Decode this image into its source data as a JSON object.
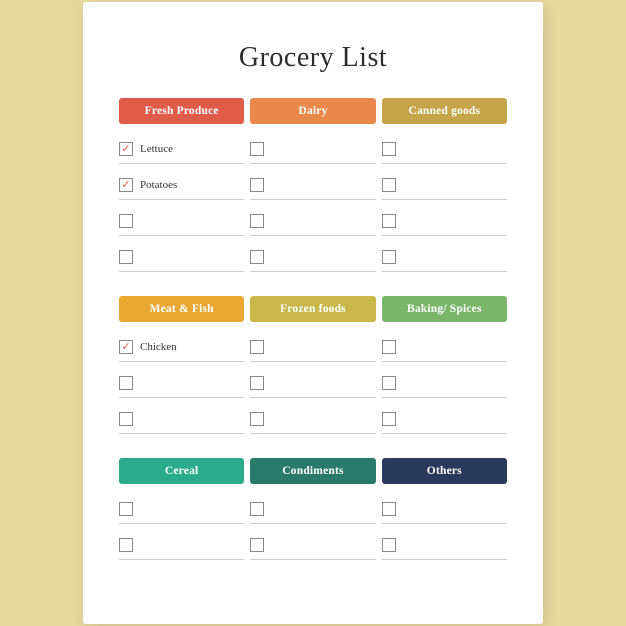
{
  "title": "Grocery List",
  "sections": [
    {
      "id": "section1",
      "categories": [
        {
          "label": "Fresh Produce",
          "class": "fresh-produce"
        },
        {
          "label": "Dairy",
          "class": "dairy"
        },
        {
          "label": "Canned goods",
          "class": "canned-goods"
        }
      ],
      "rows": [
        [
          {
            "checked": true,
            "label": "Lettuce"
          },
          {
            "checked": false,
            "label": ""
          },
          {
            "checked": false,
            "label": ""
          }
        ],
        [
          {
            "checked": true,
            "label": "Potatoes"
          },
          {
            "checked": false,
            "label": ""
          },
          {
            "checked": false,
            "label": ""
          }
        ],
        [
          {
            "checked": false,
            "label": ""
          },
          {
            "checked": false,
            "label": ""
          },
          {
            "checked": false,
            "label": ""
          }
        ],
        [
          {
            "checked": false,
            "label": ""
          },
          {
            "checked": false,
            "label": ""
          },
          {
            "checked": false,
            "label": ""
          }
        ]
      ]
    },
    {
      "id": "section2",
      "categories": [
        {
          "label": "Meat & Fish",
          "class": "meat-fish"
        },
        {
          "label": "Frozen foods",
          "class": "frozen-foods"
        },
        {
          "label": "Baking/ Spices",
          "class": "baking-spices"
        }
      ],
      "rows": [
        [
          {
            "checked": true,
            "label": "Chicken"
          },
          {
            "checked": false,
            "label": ""
          },
          {
            "checked": false,
            "label": ""
          }
        ],
        [
          {
            "checked": false,
            "label": ""
          },
          {
            "checked": false,
            "label": ""
          },
          {
            "checked": false,
            "label": ""
          }
        ],
        [
          {
            "checked": false,
            "label": ""
          },
          {
            "checked": false,
            "label": ""
          },
          {
            "checked": false,
            "label": ""
          }
        ]
      ]
    },
    {
      "id": "section3",
      "categories": [
        {
          "label": "Cereal",
          "class": "cereal"
        },
        {
          "label": "Condiments",
          "class": "condiments"
        },
        {
          "label": "Others",
          "class": "others"
        }
      ],
      "rows": [
        [
          {
            "checked": false,
            "label": ""
          },
          {
            "checked": false,
            "label": ""
          },
          {
            "checked": false,
            "label": ""
          }
        ],
        [
          {
            "checked": false,
            "label": ""
          },
          {
            "checked": false,
            "label": ""
          },
          {
            "checked": false,
            "label": ""
          }
        ]
      ]
    }
  ]
}
